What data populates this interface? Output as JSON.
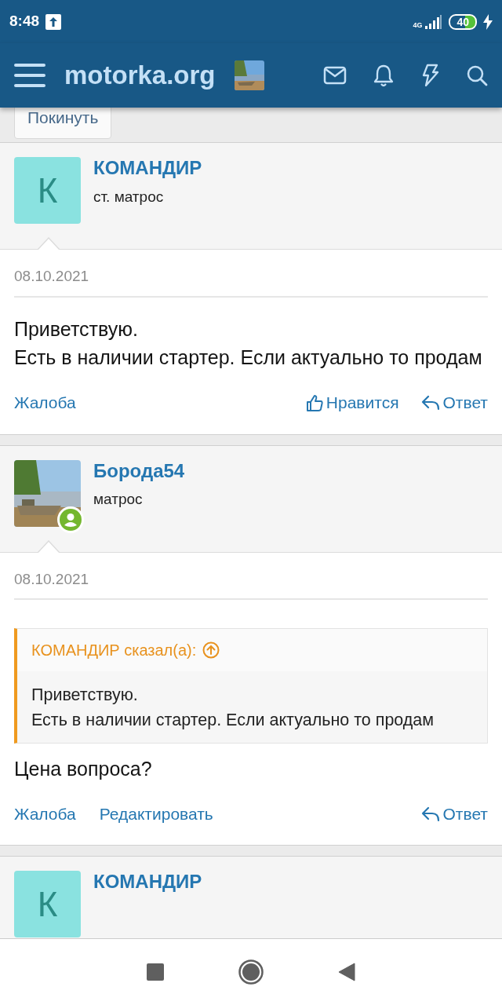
{
  "status_bar": {
    "time": "8:48",
    "network": "4G",
    "battery": "40"
  },
  "header": {
    "logo": "motorka.org"
  },
  "leave_button": "Покинуть",
  "posts": [
    {
      "author": "КОМАНДИР",
      "rank": "ст. матрос",
      "avatar": {
        "kind": "letter",
        "letter": "К"
      },
      "online": false,
      "date": "08.10.2021",
      "message": "Приветствую.\nЕсть в наличии стартер. Если актуально то продам",
      "actions": [
        {
          "kind": "report",
          "label": "Жалоба"
        },
        {
          "kind": "like",
          "label": "Нравится"
        },
        {
          "kind": "reply",
          "label": "Ответ"
        }
      ]
    },
    {
      "author": "Борода54",
      "rank": "матрос",
      "online": true,
      "date": "08.10.2021",
      "quote": {
        "header": "КОМАНДИР сказал(а):",
        "text": "Приветствую.\nЕсть в наличии стартер. Если актуально то продам"
      },
      "message": "Цена вопроса?",
      "actions": [
        {
          "kind": "report",
          "label": "Жалоба"
        },
        {
          "kind": "edit",
          "label": "Редактировать"
        },
        {
          "kind": "reply",
          "label": "Ответ"
        }
      ]
    },
    {
      "author": "КОМАНДИР",
      "avatar": {
        "kind": "letter",
        "letter": "К"
      },
      "online": false
    }
  ]
}
